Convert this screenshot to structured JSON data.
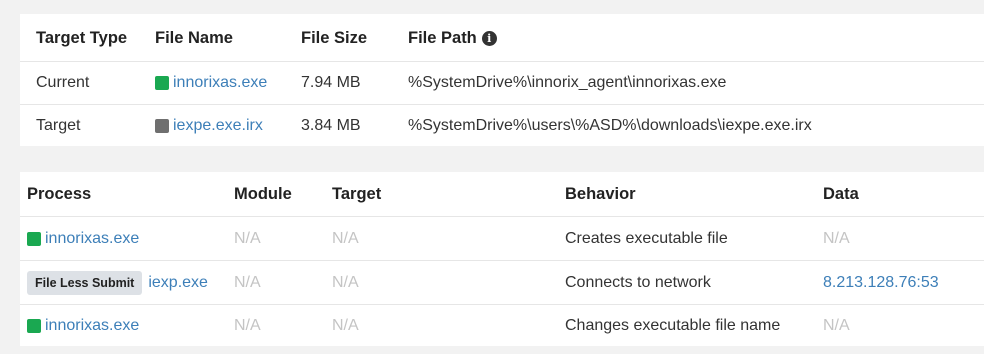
{
  "target_table": {
    "headers": {
      "target_type": "Target Type",
      "file_name": "File Name",
      "file_size": "File Size",
      "file_path": "File Path"
    },
    "rows": [
      {
        "target_type": "Current",
        "file_name": "innorixas.exe",
        "icon_color": "#1aa851",
        "file_size": "7.94 MB",
        "file_path": "%SystemDrive%\\innorix_agent\\innorixas.exe"
      },
      {
        "target_type": "Target",
        "file_name": "iexpe.exe.irx",
        "icon_color": "#6f6f6f",
        "file_size": "3.84 MB",
        "file_path": "%SystemDrive%\\users\\%ASD%\\downloads\\iexpe.exe.irx"
      }
    ]
  },
  "behavior_table": {
    "headers": {
      "process": "Process",
      "module": "Module",
      "target": "Target",
      "behavior": "Behavior",
      "data": "Data"
    },
    "rows": [
      {
        "process": "innorixas.exe",
        "module": "N/A",
        "target": "N/A",
        "behavior": "Creates executable file",
        "data": "N/A"
      },
      {
        "badge": "File Less Submit",
        "process": "iexp.exe",
        "module": "N/A",
        "target": "N/A",
        "behavior": "Connects to network",
        "data": "8.213.128.76:53"
      },
      {
        "process": "innorixas.exe",
        "module": "N/A",
        "target": "N/A",
        "behavior": "Changes executable file name",
        "data": "N/A"
      }
    ]
  },
  "icons": {
    "info": "info-circle-icon",
    "process": "file-square-icon"
  }
}
